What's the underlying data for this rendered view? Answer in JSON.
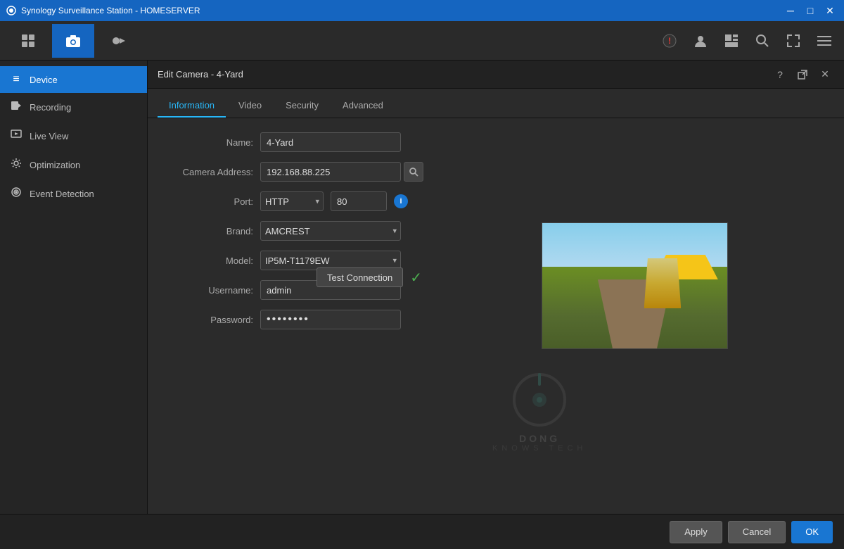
{
  "titlebar": {
    "title": "Synology Surveillance Station - HOMESERVER",
    "icon": "camera-icon"
  },
  "toolbar": {
    "items": [
      {
        "label": "Overview",
        "icon": "grid-icon",
        "active": false
      },
      {
        "label": "IP Camera",
        "icon": "camera-icon",
        "active": true
      },
      {
        "label": "Recording",
        "icon": "record-icon",
        "active": false
      }
    ],
    "right_icons": [
      "person-icon",
      "account-icon",
      "layout-icon",
      "search-icon",
      "fullscreen-icon",
      "menu-icon"
    ]
  },
  "sidebar": {
    "items": [
      {
        "label": "Device",
        "icon": "≡",
        "active": true
      },
      {
        "label": "Recording",
        "icon": "📅",
        "active": false
      },
      {
        "label": "Live View",
        "icon": "▷",
        "active": false
      },
      {
        "label": "Optimization",
        "icon": "⚙",
        "active": false
      },
      {
        "label": "Event Detection",
        "icon": "◈",
        "active": false
      }
    ]
  },
  "panel": {
    "title": "Edit Camera - 4-Yard",
    "tabs": [
      {
        "label": "Information",
        "active": true
      },
      {
        "label": "Video",
        "active": false
      },
      {
        "label": "Security",
        "active": false
      },
      {
        "label": "Advanced",
        "active": false
      }
    ]
  },
  "form": {
    "name_label": "Name:",
    "name_value": "4-Yard",
    "address_label": "Camera Address:",
    "address_value": "192.168.88.225",
    "port_label": "Port:",
    "port_protocol": "HTTP",
    "port_number": "80",
    "brand_label": "Brand:",
    "brand_value": "AMCREST",
    "model_label": "Model:",
    "model_value": "IP5M-T1179EW",
    "username_label": "Username:",
    "username_value": "admin",
    "password_label": "Password:",
    "password_value": "••••••••"
  },
  "test_connection": {
    "label": "Test Connection",
    "status": "success"
  },
  "bottom_bar": {
    "apply_label": "Apply",
    "cancel_label": "Cancel",
    "ok_label": "OK"
  },
  "watermark": {
    "text": "DONG",
    "subtext": "KNOWS TECH"
  }
}
